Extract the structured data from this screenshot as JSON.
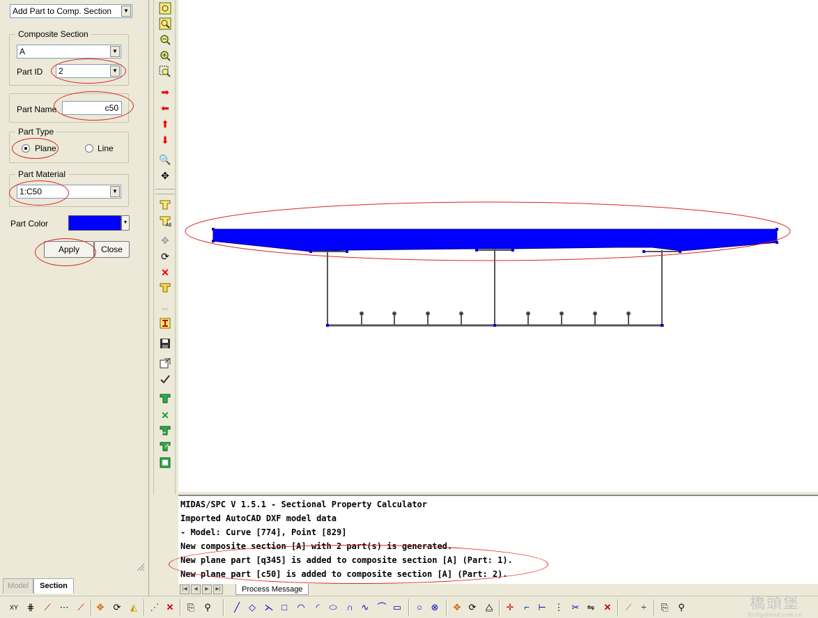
{
  "left_panel": {
    "mode_dropdown": "Add Part to Comp. Section",
    "composite_section": {
      "legend": "Composite Section",
      "value": "A",
      "part_id_label": "Part ID",
      "part_id_value": "2"
    },
    "part_name": {
      "label": "Part Name",
      "value": "c50"
    },
    "part_type": {
      "legend": "Part Type",
      "plane_label": "Plane",
      "line_label": "Line",
      "selected": "Plane"
    },
    "part_material": {
      "legend": "Part Material",
      "value": "1:C50"
    },
    "part_color": {
      "label": "Part Color",
      "color": "#0000ff"
    },
    "apply_label": "Apply",
    "close_label": "Close",
    "tabs": [
      {
        "label": "Model",
        "active": false
      },
      {
        "label": "Section",
        "active": true
      }
    ]
  },
  "vertical_toolbar": {
    "icons": [
      "zoom-fit-icon",
      "zoom-window-icon",
      "zoom-out-icon",
      "zoom-in-icon",
      "zoom-dynamic-icon",
      "pan-right-icon",
      "pan-left-icon",
      "pan-up-icon",
      "pan-down-icon",
      "zoom-realtime-icon",
      "pan-icon",
      "section-new-icon",
      "section-edit-icon",
      "move-icon",
      "rotate-icon",
      "delete-icon",
      "section-copy-icon",
      "mirror-icon",
      "calculate-property-icon",
      "save-icon",
      "export-icon",
      "check-icon",
      "composite-add-icon",
      "composite-delete-icon",
      "composite-import-icon",
      "composite-result-icon"
    ]
  },
  "messages": {
    "lines": [
      "MIDAS/SPC V 1.5.1 - Sectional Property Calculator",
      "Imported AutoCAD DXF model data",
      "- Model: Curve [774], Point [829]",
      "New composite section [A] with 2 part(s) is generated.",
      "New plane part [q345] is added to composite section [A] (Part: 1).",
      "New plane part [c50] is added to composite section [A] (Part: 2)."
    ],
    "tab_label": "Process Message"
  },
  "watermark": {
    "text": "橋頭堡",
    "sub": "Bridgehead.com.cn"
  },
  "colors": {
    "part_fill": "#0000ff",
    "annotation": "#d22222",
    "panel_bg": "#ece9d8"
  }
}
